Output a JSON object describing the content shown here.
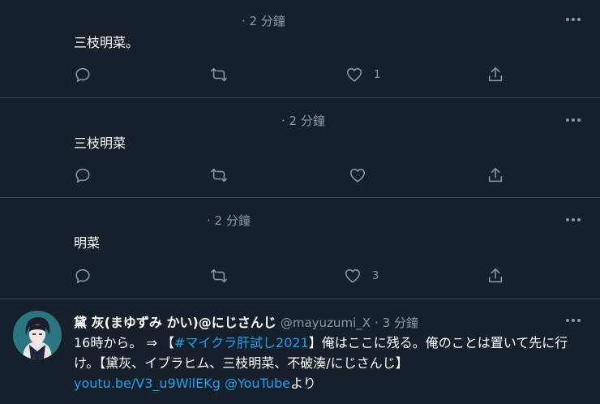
{
  "tweets": [
    {
      "time": "· 2 分鐘",
      "text": "三枝明菜。",
      "like_count": "1",
      "retweet_count": "",
      "reply_count": ""
    },
    {
      "time": "· 2 分鐘",
      "text": "三枝明菜",
      "like_count": "",
      "retweet_count": "",
      "reply_count": ""
    },
    {
      "time": "· 2 分鐘",
      "text": "明菜",
      "like_count": "3",
      "retweet_count": "",
      "reply_count": ""
    }
  ],
  "last_tweet": {
    "name": "黛 灰(まゆずみ かい)@にじさんじ",
    "handle": "@mayuzumi_X",
    "time": "· 3 分鐘",
    "line1_pre": "16時から。 ⇒ 【",
    "hashtag": "#マイクラ肝試し2021",
    "line1_post": "】俺はここに残る。俺のことは置いて先に行け。【黛灰、イブラヒム、三枝明菜、不破湊/にじさんじ】",
    "link_url": "youtu.be/V3_u9WilEKg",
    "link_mention": "@YouTube",
    "link_suffix": "より"
  },
  "colors": {
    "background": "#15202b",
    "divider": "#38444d",
    "secondary_text": "#8899a6",
    "link": "#1da1f2"
  },
  "icons": [
    "reply-icon",
    "retweet-icon",
    "like-icon",
    "share-icon",
    "more-icon"
  ]
}
